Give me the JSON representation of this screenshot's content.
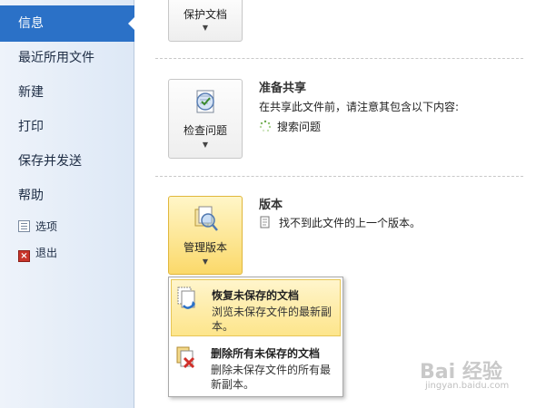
{
  "sidebar": {
    "items": [
      {
        "label": "信息"
      },
      {
        "label": "最近所用文件"
      },
      {
        "label": "新建"
      },
      {
        "label": "打印"
      },
      {
        "label": "保存并发送"
      },
      {
        "label": "帮助"
      }
    ],
    "options_label": "选项",
    "exit_label": "退出"
  },
  "protect": {
    "button_label": "保护文档"
  },
  "prepare": {
    "button_label": "检查问题",
    "title": "准备共享",
    "desc": "在共享此文件前，请注意其包含以下内容:",
    "item": "搜索问题"
  },
  "versions": {
    "button_label": "管理版本",
    "title": "版本",
    "desc": "找不到此文件的上一个版本。"
  },
  "menu": {
    "items": [
      {
        "title": "恢复未保存的文档",
        "desc": "浏览未保存文件的最新副本。"
      },
      {
        "title": "删除所有未保存的文档",
        "desc": "删除未保存文件的所有最新副本。"
      }
    ]
  },
  "watermark": {
    "text": "Bai 经验",
    "sub": "jingyan.baidu.com"
  },
  "colors": {
    "accent": "#2b71c7",
    "highlight": "#fbd96a"
  }
}
